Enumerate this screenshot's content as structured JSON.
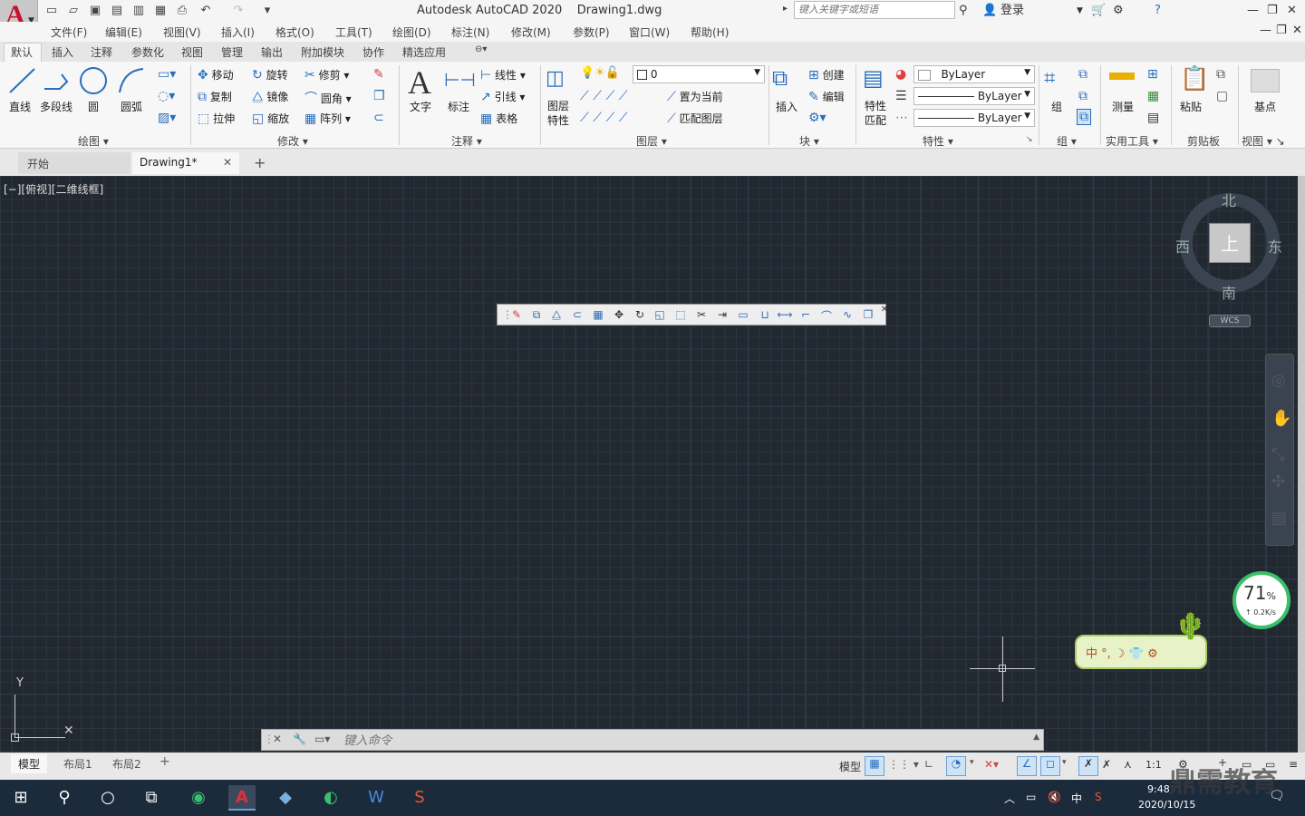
{
  "app": {
    "title": "Autodesk AutoCAD 2020",
    "file": "Drawing1.dwg",
    "logo": "A"
  },
  "search": {
    "placeholder": "键入关键字或短语"
  },
  "signin": "登录",
  "menubar": [
    "文件(F)",
    "编辑(E)",
    "视图(V)",
    "插入(I)",
    "格式(O)",
    "工具(T)",
    "绘图(D)",
    "标注(N)",
    "修改(M)",
    "参数(P)",
    "窗口(W)",
    "帮助(H)"
  ],
  "ribbon_tabs": [
    "默认",
    "插入",
    "注释",
    "参数化",
    "视图",
    "管理",
    "输出",
    "附加模块",
    "协作",
    "精选应用"
  ],
  "draw": {
    "line": "直线",
    "polyline": "多段线",
    "circle": "圆",
    "arc": "圆弧",
    "title": "绘图"
  },
  "modify": {
    "move": "移动",
    "rotate": "旋转",
    "trim": "修剪",
    "copy": "复制",
    "mirror": "镜像",
    "fillet": "圆角",
    "stretch": "拉伸",
    "scale": "缩放",
    "array": "阵列",
    "title": "修改"
  },
  "annotation": {
    "text": "文字",
    "dimension": "标注",
    "linear": "线性",
    "leader": "引线",
    "table": "表格",
    "title": "注释"
  },
  "layers": {
    "props": "图层特性",
    "props_a": "图层",
    "props_b": "特性",
    "current": "0",
    "make_current": "置为当前",
    "match": "匹配图层",
    "title": "图层"
  },
  "block": {
    "insert": "插入",
    "create": "创建",
    "edit": "编辑",
    "title": "块"
  },
  "properties": {
    "match_a": "特性",
    "match_b": "匹配",
    "bylayer": "ByLayer",
    "title": "特性"
  },
  "groups": {
    "group": "组",
    "title": "组"
  },
  "utilities": {
    "measure": "测量",
    "title": "实用工具"
  },
  "clipboard": {
    "paste": "粘贴",
    "title": "剪贴板"
  },
  "view": {
    "base": "基点",
    "title": "视图"
  },
  "doc_tabs": {
    "start": "开始",
    "drawing": "Drawing1*"
  },
  "viewport_label": "[−][俯视][二维线框]",
  "viewcube": {
    "north": "北",
    "south": "南",
    "east": "东",
    "west": "西",
    "top": "上",
    "wcs": "WCS"
  },
  "ucs": {
    "y": "Y"
  },
  "network": {
    "percent": "71",
    "unit": "%",
    "speed": "↑ 0.2K/s"
  },
  "ime": {
    "text": "中 °, ☽ 👕 ⚙"
  },
  "command": {
    "placeholder": "键入命令"
  },
  "layout_tabs": [
    "模型",
    "布局1",
    "布局2"
  ],
  "status": {
    "model": "模型",
    "scale": "1:1"
  },
  "clock": {
    "time": "9:48",
    "date": "2020/10/15"
  },
  "tray": {
    "ime": "中"
  },
  "watermark": "鼎需教育"
}
